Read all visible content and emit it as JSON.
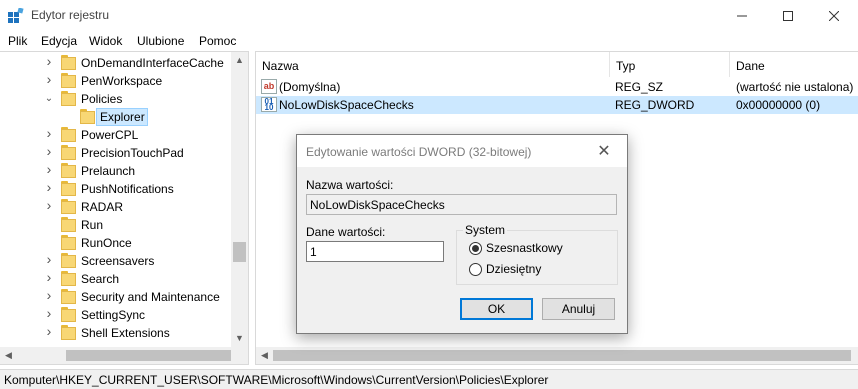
{
  "window": {
    "title": "Edytor rejestru"
  },
  "menu": [
    "Plik",
    "Edycja",
    "Widok",
    "Ulubione",
    "Pomoc"
  ],
  "tree": {
    "items": [
      {
        "label": "OnDemandInterfaceCache",
        "expander": "collapsed"
      },
      {
        "label": "PenWorkspace",
        "expander": "collapsed"
      },
      {
        "label": "Policies",
        "expander": "expanded"
      },
      {
        "label": "Explorer",
        "expander": "none",
        "selected": true
      },
      {
        "label": "PowerCPL",
        "expander": "collapsed"
      },
      {
        "label": "PrecisionTouchPad",
        "expander": "collapsed"
      },
      {
        "label": "Prelaunch",
        "expander": "collapsed"
      },
      {
        "label": "PushNotifications",
        "expander": "collapsed"
      },
      {
        "label": "RADAR",
        "expander": "collapsed"
      },
      {
        "label": "Run",
        "expander": "none"
      },
      {
        "label": "RunOnce",
        "expander": "none"
      },
      {
        "label": "Screensavers",
        "expander": "collapsed"
      },
      {
        "label": "Search",
        "expander": "collapsed"
      },
      {
        "label": "Security and Maintenance",
        "expander": "collapsed"
      },
      {
        "label": "SettingSync",
        "expander": "collapsed"
      },
      {
        "label": "Shell Extensions",
        "expander": "collapsed"
      }
    ]
  },
  "list": {
    "columns": [
      "Nazwa",
      "Typ",
      "Dane"
    ],
    "rows": [
      {
        "icon": "string-value-icon",
        "name": "(Domyślna)",
        "type": "REG_SZ",
        "data": "(wartość nie ustalona)"
      },
      {
        "icon": "dword-value-icon",
        "name": "NoLowDiskSpaceChecks",
        "type": "REG_DWORD",
        "data": "0x00000000 (0)",
        "selected": true
      }
    ]
  },
  "status": {
    "path": "Komputer\\HKEY_CURRENT_USER\\SOFTWARE\\Microsoft\\Windows\\CurrentVersion\\Policies\\Explorer"
  },
  "dialog": {
    "title": "Edytowanie wartości DWORD (32-bitowej)",
    "value_name_label": "Nazwa wartości:",
    "value_name": "NoLowDiskSpaceChecks",
    "value_data_label": "Dane wartości:",
    "value_data": "1",
    "base_group_label": "System",
    "radio_hex": "Szesnastkowy",
    "radio_dec": "Dziesiętny",
    "selected_base": "hex",
    "ok": "OK",
    "cancel": "Anuluj"
  },
  "colors": {
    "selection": "#cce8ff",
    "folder": "#f8d775",
    "accent": "#0078d7"
  }
}
